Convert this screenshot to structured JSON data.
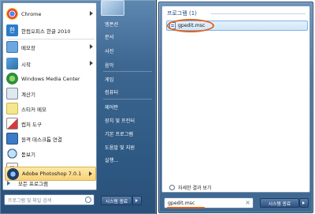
{
  "start_menu": {
    "programs": [
      {
        "label": "Chrome",
        "icon": "chrome-icon",
        "has_submenu": true
      },
      {
        "label": "한컴오피스 한글 2010",
        "icon": "hwp-icon",
        "has_submenu": false
      },
      {
        "label": "메모장",
        "icon": "notepad-icon",
        "has_submenu": true
      },
      {
        "label": "시작",
        "icon": "start-icon",
        "has_submenu": true
      },
      {
        "label": "Windows Media Center",
        "icon": "media-center-icon",
        "has_submenu": false
      },
      {
        "label": "계산기",
        "icon": "calculator-icon",
        "has_submenu": false
      },
      {
        "label": "스티커 메모",
        "icon": "sticky-notes-icon",
        "has_submenu": false
      },
      {
        "label": "캡처 도구",
        "icon": "snipping-tool-icon",
        "has_submenu": false
      },
      {
        "label": "원격 데스크톱 연결",
        "icon": "remote-desktop-icon",
        "has_submenu": false
      },
      {
        "label": "돋보기",
        "icon": "magnifier-icon",
        "has_submenu": false
      },
      {
        "label": "카드놀이",
        "icon": "solitaire-icon",
        "has_submenu": false
      },
      {
        "label": "Adobe Photoshop 7.0.1",
        "icon": "photoshop-icon",
        "has_submenu": true,
        "highlighted": true
      }
    ],
    "all_programs_label": "모든 프로그램",
    "search_placeholder": "프로그램 및 파일 검색",
    "links": [
      "엠폰션",
      "문서",
      "사진",
      "음악",
      "게임",
      "컴퓨터",
      "제어판",
      "장치 및 프린터",
      "기본 프로그램",
      "도움말 및 지원",
      "실행..."
    ],
    "shutdown_label": "시스템 종료"
  },
  "results_panel": {
    "header": "프로그램 (1)",
    "result_item": "gpedit.msc",
    "see_more": "자세한 결과 보기",
    "query": "gpedit.msc",
    "clear_glyph": "×",
    "shutdown_label": "시스템 종료"
  },
  "colors": {
    "highlight_ellipse": "#e2621c",
    "accent_blue": "#1f4b83",
    "selection_yellow": "#f9d17a"
  }
}
